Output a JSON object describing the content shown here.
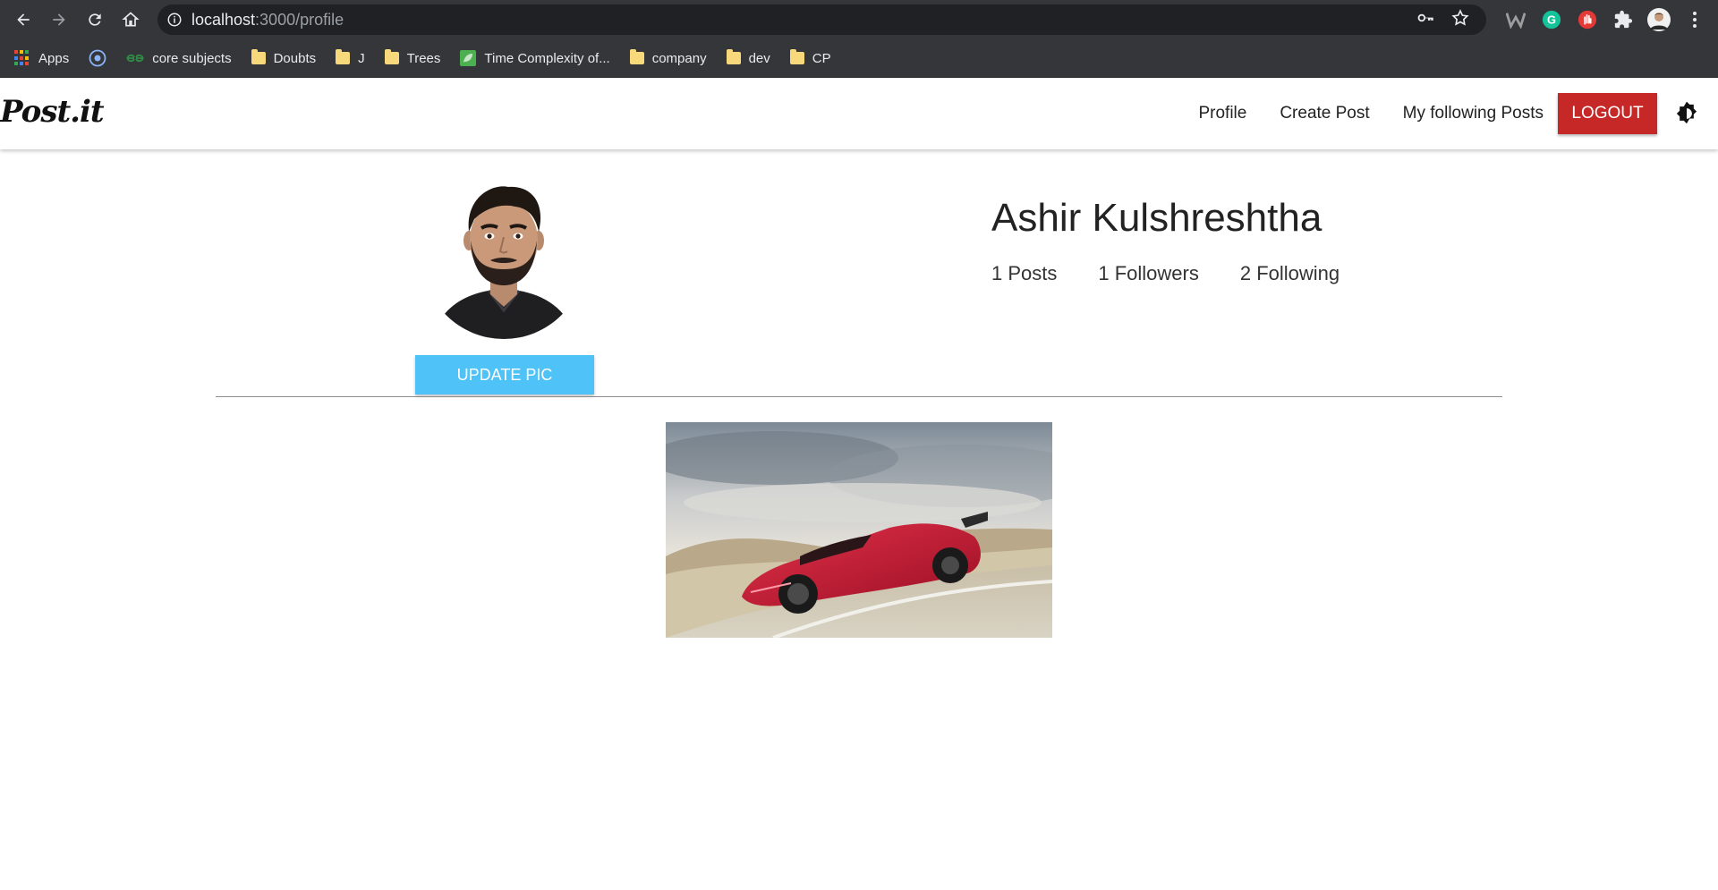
{
  "browser": {
    "url_host": "localhost",
    "url_path": ":3000/profile"
  },
  "bookmarks": [
    {
      "label": "Apps",
      "icon": "apps-grid-icon"
    },
    {
      "label": "",
      "icon": "circle-target-icon"
    },
    {
      "label": "core subjects",
      "icon": "gfg-icon"
    },
    {
      "label": "Doubts",
      "icon": "folder-icon"
    },
    {
      "label": "J",
      "icon": "folder-icon"
    },
    {
      "label": "Trees",
      "icon": "folder-icon"
    },
    {
      "label": "Time Complexity of...",
      "icon": "leaf-icon"
    },
    {
      "label": "company",
      "icon": "folder-icon"
    },
    {
      "label": "dev",
      "icon": "folder-icon"
    },
    {
      "label": "CP",
      "icon": "folder-icon"
    }
  ],
  "app": {
    "brand": "Post.it",
    "nav": {
      "profile": "Profile",
      "create_post": "Create Post",
      "following_posts": "My following Posts",
      "logout": "LOGOUT"
    }
  },
  "profile": {
    "name": "Ashir Kulshreshtha",
    "posts": "1 Posts",
    "followers": "1 Followers",
    "following": "2 Following",
    "update_pic": "UPDATE PIC"
  },
  "colors": {
    "logout": "#c62828",
    "update_pic": "#4fc3f7",
    "chrome_bar": "#35363a"
  }
}
